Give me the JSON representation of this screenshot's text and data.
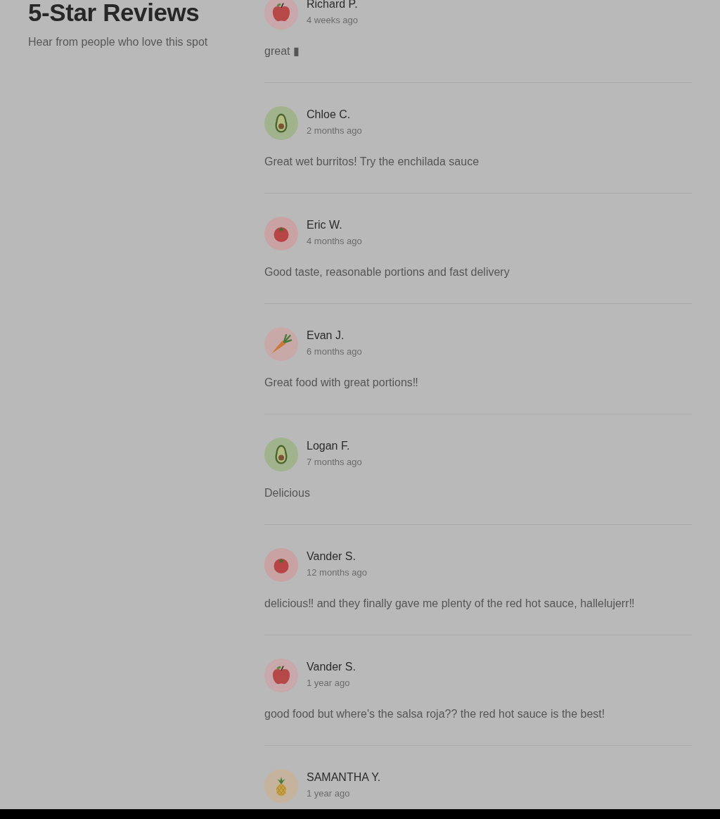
{
  "header": {
    "title": "5-Star Reviews",
    "subtitle": "Hear from people who love this spot"
  },
  "reviews": [
    {
      "kind": "apple",
      "name": "Richard P.",
      "time": "4 weeks ago",
      "text": "great ▮"
    },
    {
      "kind": "avocado",
      "name": "Chloe C.",
      "time": "2 months ago",
      "text": "Great wet burritos! Try the enchilada sauce"
    },
    {
      "kind": "tomato",
      "name": "Eric W.",
      "time": "4 months ago",
      "text": "Good taste, reasonable portions and fast delivery"
    },
    {
      "kind": "carrot",
      "name": "Evan J.",
      "time": "6 months ago",
      "text": "Great food with great portions‼"
    },
    {
      "kind": "avocado",
      "name": "Logan F.",
      "time": "7 months ago",
      "text": "Delicious"
    },
    {
      "kind": "tomato",
      "name": "Vander S.",
      "time": "12 months ago",
      "text": "delicious‼ and they finally gave me plenty of the red hot sauce, hallelujerr‼"
    },
    {
      "kind": "apple",
      "name": "Vander S.",
      "time": "1 year ago",
      "text": "good food but where's the salsa roja?? the red hot sauce is the best!"
    },
    {
      "kind": "pineapple",
      "name": "SAMANTHA Y.",
      "time": "1 year ago"
    }
  ]
}
